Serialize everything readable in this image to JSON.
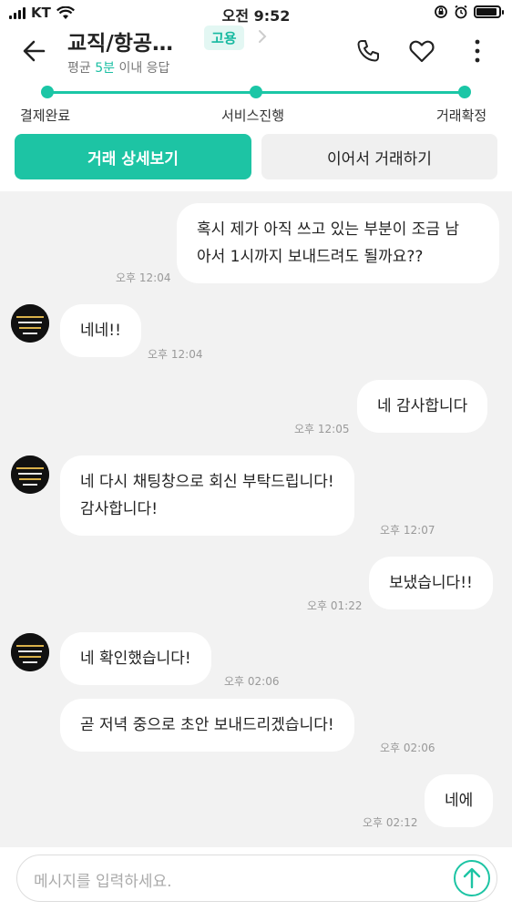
{
  "status_bar": {
    "carrier": "KT",
    "time": "오전 9:52"
  },
  "header": {
    "title": "교직/항공…",
    "tag": "고용",
    "response_prefix": "평균 ",
    "response_highlight": "5분",
    "response_suffix": " 이내 응답"
  },
  "progress": {
    "steps": [
      "결제완료",
      "서비스진행",
      "거래확정"
    ]
  },
  "actions": {
    "detail_label": "거래 상세보기",
    "continue_label": "이어서 거래하기"
  },
  "messages": [
    {
      "side": "right",
      "line1": "혹시 제가 아직 쓰고 있는 부분이 조금 남",
      "line2": "아서 1시까지 보내드려도 될까요??",
      "time": "오후 12:04"
    },
    {
      "side": "left",
      "line1": "네네!!",
      "time": "오후 12:04"
    },
    {
      "side": "right",
      "line1": "네 감사합니다",
      "time": "오후 12:05"
    },
    {
      "side": "left",
      "line1": "네 다시 채팅창으로 회신 부탁드립니다!",
      "line2": "감사합니다!",
      "time": "오후 12:07"
    },
    {
      "side": "right",
      "line1": "보냈습니다!!",
      "time": "오후 01:22"
    },
    {
      "side": "left",
      "line1": "네 확인했습니다!",
      "time": "오후 02:06"
    },
    {
      "side": "left",
      "line1": "곧 저녁 중으로 초안 보내드리겠습니다!",
      "time": "오후 02:06"
    },
    {
      "side": "right",
      "line1": "네에",
      "time": "오후 02:12"
    }
  ],
  "input": {
    "placeholder": "메시지를 입력하세요."
  },
  "colors": {
    "accent": "#1dc4a4",
    "chat_bg": "#f2f2f2",
    "tag_bg": "#e3f7f3"
  },
  "icons": [
    "back-arrow-icon",
    "chevron-right-icon",
    "phone-icon",
    "heart-icon",
    "more-vertical-icon",
    "send-arrow-icon"
  ]
}
